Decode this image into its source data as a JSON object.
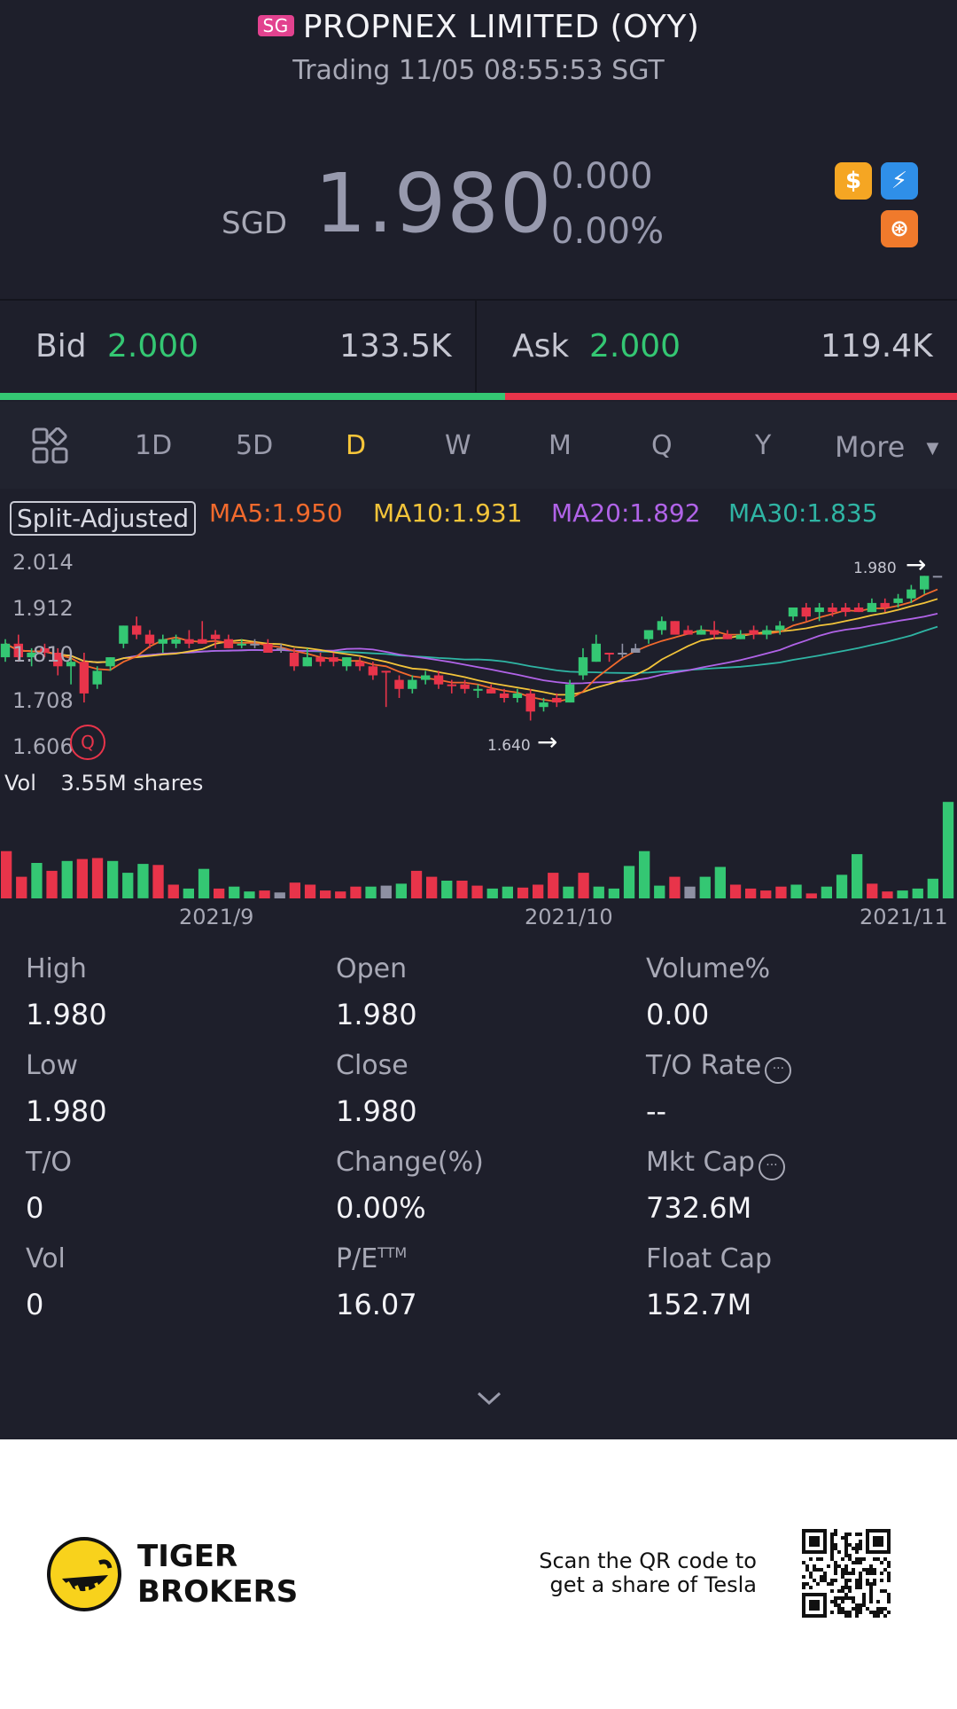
{
  "header": {
    "market_badge": "SG",
    "title": "PROPNEX LIMITED (OYY)",
    "subtitle": "Trading 11/05 08:55:53 SGT"
  },
  "quote": {
    "currency": "SGD",
    "price": "1.980",
    "change": "0.000",
    "change_pct": "0.00%",
    "badges": [
      {
        "icon": "dollar-icon",
        "glyph": "$",
        "color": "#f5a623"
      },
      {
        "icon": "lightning-icon",
        "glyph": "⚡",
        "color": "#2f8fe8"
      },
      {
        "icon": "margin-icon",
        "glyph": "⊛",
        "color": "#f07a2c"
      }
    ]
  },
  "bidask": {
    "bid_label": "Bid",
    "bid_price": "2.000",
    "bid_volume": "133.5K",
    "ask_label": "Ask",
    "ask_price": "2.000",
    "ask_volume": "119.4K",
    "bid_ratio": 0.528,
    "bid_color": "#34c773",
    "ask_color": "#e8344a"
  },
  "tabs": {
    "items": [
      "1D",
      "5D",
      "D",
      "W",
      "M",
      "Q",
      "Y"
    ],
    "active": "D",
    "more_label": "More"
  },
  "indicators": {
    "split_label": "Split-Adjusted",
    "ma5": "MA5:1.950",
    "ma10": "MA10:1.931",
    "ma20": "MA20:1.892",
    "ma30": "MA30:1.835",
    "colors": {
      "ma5": "#f26a2d",
      "ma10": "#f3c43a",
      "ma20": "#b163e8",
      "ma30": "#2fb5a4"
    }
  },
  "chart_data": {
    "type": "candlestick",
    "y_ticks": [
      "2.014",
      "1.912",
      "1.810",
      "1.708",
      "1.606"
    ],
    "ylim": [
      1.606,
      2.014
    ],
    "high_marker": "1.980",
    "low_marker": "1.640",
    "x_ticks": [
      "2021/9",
      "2021/10",
      "2021/11"
    ],
    "volume_label": "Vol",
    "volume_value": "3.55M shares",
    "candles": [
      {
        "o": 1.8,
        "h": 1.84,
        "l": 1.79,
        "c": 1.83,
        "d": "up"
      },
      {
        "o": 1.83,
        "h": 1.85,
        "l": 1.79,
        "c": 1.8,
        "d": "down"
      },
      {
        "o": 1.8,
        "h": 1.82,
        "l": 1.78,
        "c": 1.81,
        "d": "up"
      },
      {
        "o": 1.82,
        "h": 1.83,
        "l": 1.8,
        "c": 1.81,
        "d": "down"
      },
      {
        "o": 1.81,
        "h": 1.82,
        "l": 1.76,
        "c": 1.78,
        "d": "down"
      },
      {
        "o": 1.78,
        "h": 1.8,
        "l": 1.74,
        "c": 1.79,
        "d": "up"
      },
      {
        "o": 1.79,
        "h": 1.81,
        "l": 1.7,
        "c": 1.72,
        "d": "down"
      },
      {
        "o": 1.74,
        "h": 1.78,
        "l": 1.73,
        "c": 1.77,
        "d": "up"
      },
      {
        "o": 1.78,
        "h": 1.8,
        "l": 1.77,
        "c": 1.8,
        "d": "up"
      },
      {
        "o": 1.83,
        "h": 1.87,
        "l": 1.82,
        "c": 1.87,
        "d": "up"
      },
      {
        "o": 1.87,
        "h": 1.89,
        "l": 1.84,
        "c": 1.85,
        "d": "down"
      },
      {
        "o": 1.85,
        "h": 1.86,
        "l": 1.82,
        "c": 1.83,
        "d": "down"
      },
      {
        "o": 1.83,
        "h": 1.85,
        "l": 1.81,
        "c": 1.84,
        "d": "up"
      },
      {
        "o": 1.84,
        "h": 1.85,
        "l": 1.82,
        "c": 1.83,
        "d": "up"
      },
      {
        "o": 1.84,
        "h": 1.86,
        "l": 1.82,
        "c": 1.83,
        "d": "down"
      },
      {
        "o": 1.83,
        "h": 1.88,
        "l": 1.83,
        "c": 1.84,
        "d": "down"
      },
      {
        "o": 1.85,
        "h": 1.86,
        "l": 1.82,
        "c": 1.84,
        "d": "down"
      },
      {
        "o": 1.84,
        "h": 1.85,
        "l": 1.82,
        "c": 1.82,
        "d": "down"
      },
      {
        "o": 1.83,
        "h": 1.84,
        "l": 1.82,
        "c": 1.83,
        "d": "up"
      },
      {
        "o": 1.83,
        "h": 1.84,
        "l": 1.82,
        "c": 1.83,
        "d": "flat"
      },
      {
        "o": 1.83,
        "h": 1.84,
        "l": 1.81,
        "c": 1.81,
        "d": "down"
      },
      {
        "o": 1.82,
        "h": 1.83,
        "l": 1.81,
        "c": 1.82,
        "d": "flat"
      },
      {
        "o": 1.81,
        "h": 1.82,
        "l": 1.77,
        "c": 1.78,
        "d": "down"
      },
      {
        "o": 1.78,
        "h": 1.82,
        "l": 1.78,
        "c": 1.8,
        "d": "up"
      },
      {
        "o": 1.8,
        "h": 1.81,
        "l": 1.78,
        "c": 1.79,
        "d": "down"
      },
      {
        "o": 1.8,
        "h": 1.81,
        "l": 1.78,
        "c": 1.79,
        "d": "down"
      },
      {
        "o": 1.78,
        "h": 1.8,
        "l": 1.77,
        "c": 1.8,
        "d": "up"
      },
      {
        "o": 1.79,
        "h": 1.8,
        "l": 1.77,
        "c": 1.78,
        "d": "down"
      },
      {
        "o": 1.78,
        "h": 1.79,
        "l": 1.75,
        "c": 1.76,
        "d": "down"
      },
      {
        "o": 1.77,
        "h": 1.77,
        "l": 1.69,
        "c": 1.77,
        "d": "down"
      },
      {
        "o": 1.75,
        "h": 1.76,
        "l": 1.71,
        "c": 1.73,
        "d": "down"
      },
      {
        "o": 1.73,
        "h": 1.76,
        "l": 1.72,
        "c": 1.75,
        "d": "up"
      },
      {
        "o": 1.75,
        "h": 1.77,
        "l": 1.74,
        "c": 1.76,
        "d": "up"
      },
      {
        "o": 1.76,
        "h": 1.77,
        "l": 1.73,
        "c": 1.74,
        "d": "down"
      },
      {
        "o": 1.74,
        "h": 1.75,
        "l": 1.72,
        "c": 1.74,
        "d": "down"
      },
      {
        "o": 1.74,
        "h": 1.75,
        "l": 1.72,
        "c": 1.73,
        "d": "down"
      },
      {
        "o": 1.73,
        "h": 1.74,
        "l": 1.71,
        "c": 1.73,
        "d": "up"
      },
      {
        "o": 1.73,
        "h": 1.74,
        "l": 1.72,
        "c": 1.72,
        "d": "down"
      },
      {
        "o": 1.72,
        "h": 1.73,
        "l": 1.7,
        "c": 1.71,
        "d": "down"
      },
      {
        "o": 1.71,
        "h": 1.73,
        "l": 1.7,
        "c": 1.72,
        "d": "up"
      },
      {
        "o": 1.72,
        "h": 1.73,
        "l": 1.66,
        "c": 1.68,
        "d": "down"
      },
      {
        "o": 1.69,
        "h": 1.71,
        "l": 1.68,
        "c": 1.7,
        "d": "up"
      },
      {
        "o": 1.71,
        "h": 1.72,
        "l": 1.69,
        "c": 1.7,
        "d": "down"
      },
      {
        "o": 1.7,
        "h": 1.75,
        "l": 1.7,
        "c": 1.74,
        "d": "up"
      },
      {
        "o": 1.76,
        "h": 1.82,
        "l": 1.75,
        "c": 1.8,
        "d": "up"
      },
      {
        "o": 1.79,
        "h": 1.85,
        "l": 1.79,
        "c": 1.83,
        "d": "up"
      },
      {
        "o": 1.81,
        "h": 1.81,
        "l": 1.79,
        "c": 1.81,
        "d": "down"
      },
      {
        "o": 1.81,
        "h": 1.83,
        "l": 1.8,
        "c": 1.81,
        "d": "flat"
      },
      {
        "o": 1.81,
        "h": 1.83,
        "l": 1.81,
        "c": 1.82,
        "d": "flat"
      },
      {
        "o": 1.84,
        "h": 1.86,
        "l": 1.83,
        "c": 1.86,
        "d": "up"
      },
      {
        "o": 1.86,
        "h": 1.89,
        "l": 1.85,
        "c": 1.88,
        "d": "up"
      },
      {
        "o": 1.88,
        "h": 1.88,
        "l": 1.86,
        "c": 1.85,
        "d": "down"
      },
      {
        "o": 1.86,
        "h": 1.87,
        "l": 1.85,
        "c": 1.85,
        "d": "down"
      },
      {
        "o": 1.85,
        "h": 1.87,
        "l": 1.85,
        "c": 1.86,
        "d": "up"
      },
      {
        "o": 1.86,
        "h": 1.88,
        "l": 1.84,
        "c": 1.85,
        "d": "down"
      },
      {
        "o": 1.85,
        "h": 1.86,
        "l": 1.84,
        "c": 1.84,
        "d": "down"
      },
      {
        "o": 1.84,
        "h": 1.86,
        "l": 1.84,
        "c": 1.85,
        "d": "up"
      },
      {
        "o": 1.85,
        "h": 1.87,
        "l": 1.84,
        "c": 1.86,
        "d": "down"
      },
      {
        "o": 1.85,
        "h": 1.87,
        "l": 1.84,
        "c": 1.86,
        "d": "up"
      },
      {
        "o": 1.86,
        "h": 1.88,
        "l": 1.85,
        "c": 1.87,
        "d": "up"
      },
      {
        "o": 1.89,
        "h": 1.91,
        "l": 1.88,
        "c": 1.91,
        "d": "up"
      },
      {
        "o": 1.91,
        "h": 1.92,
        "l": 1.88,
        "c": 1.89,
        "d": "down"
      },
      {
        "o": 1.9,
        "h": 1.92,
        "l": 1.88,
        "c": 1.91,
        "d": "up"
      },
      {
        "o": 1.91,
        "h": 1.92,
        "l": 1.89,
        "c": 1.9,
        "d": "down"
      },
      {
        "o": 1.9,
        "h": 1.92,
        "l": 1.89,
        "c": 1.91,
        "d": "down"
      },
      {
        "o": 1.91,
        "h": 1.92,
        "l": 1.9,
        "c": 1.9,
        "d": "down"
      },
      {
        "o": 1.9,
        "h": 1.93,
        "l": 1.9,
        "c": 1.92,
        "d": "up"
      },
      {
        "o": 1.92,
        "h": 1.93,
        "l": 1.9,
        "c": 1.91,
        "d": "down"
      },
      {
        "o": 1.92,
        "h": 1.94,
        "l": 1.91,
        "c": 1.93,
        "d": "up"
      },
      {
        "o": 1.93,
        "h": 1.96,
        "l": 1.92,
        "c": 1.95,
        "d": "up"
      },
      {
        "o": 1.95,
        "h": 1.98,
        "l": 1.94,
        "c": 1.98,
        "d": "up"
      },
      {
        "o": 1.98,
        "h": 1.98,
        "l": 1.98,
        "c": 1.98,
        "d": "flat"
      }
    ],
    "volumes": [
      {
        "v": 0.48,
        "d": "down"
      },
      {
        "v": 0.22,
        "d": "down"
      },
      {
        "v": 0.36,
        "d": "up"
      },
      {
        "v": 0.28,
        "d": "down"
      },
      {
        "v": 0.38,
        "d": "up"
      },
      {
        "v": 0.4,
        "d": "down"
      },
      {
        "v": 0.41,
        "d": "down"
      },
      {
        "v": 0.38,
        "d": "up"
      },
      {
        "v": 0.26,
        "d": "up"
      },
      {
        "v": 0.35,
        "d": "up"
      },
      {
        "v": 0.34,
        "d": "down"
      },
      {
        "v": 0.14,
        "d": "down"
      },
      {
        "v": 0.1,
        "d": "up"
      },
      {
        "v": 0.3,
        "d": "up"
      },
      {
        "v": 0.1,
        "d": "down"
      },
      {
        "v": 0.12,
        "d": "up"
      },
      {
        "v": 0.07,
        "d": "up"
      },
      {
        "v": 0.08,
        "d": "down"
      },
      {
        "v": 0.06,
        "d": "flat"
      },
      {
        "v": 0.16,
        "d": "down"
      },
      {
        "v": 0.14,
        "d": "down"
      },
      {
        "v": 0.08,
        "d": "down"
      },
      {
        "v": 0.07,
        "d": "down"
      },
      {
        "v": 0.12,
        "d": "down"
      },
      {
        "v": 0.12,
        "d": "up"
      },
      {
        "v": 0.13,
        "d": "flat"
      },
      {
        "v": 0.15,
        "d": "up"
      },
      {
        "v": 0.28,
        "d": "down"
      },
      {
        "v": 0.22,
        "d": "down"
      },
      {
        "v": 0.18,
        "d": "up"
      },
      {
        "v": 0.18,
        "d": "down"
      },
      {
        "v": 0.13,
        "d": "down"
      },
      {
        "v": 0.1,
        "d": "up"
      },
      {
        "v": 0.12,
        "d": "up"
      },
      {
        "v": 0.11,
        "d": "down"
      },
      {
        "v": 0.14,
        "d": "down"
      },
      {
        "v": 0.26,
        "d": "down"
      },
      {
        "v": 0.12,
        "d": "up"
      },
      {
        "v": 0.26,
        "d": "down"
      },
      {
        "v": 0.12,
        "d": "up"
      },
      {
        "v": 0.1,
        "d": "up"
      },
      {
        "v": 0.33,
        "d": "up"
      },
      {
        "v": 0.48,
        "d": "up"
      },
      {
        "v": 0.13,
        "d": "up"
      },
      {
        "v": 0.22,
        "d": "down"
      },
      {
        "v": 0.12,
        "d": "flat"
      },
      {
        "v": 0.22,
        "d": "up"
      },
      {
        "v": 0.32,
        "d": "up"
      },
      {
        "v": 0.14,
        "d": "down"
      },
      {
        "v": 0.1,
        "d": "down"
      },
      {
        "v": 0.08,
        "d": "down"
      },
      {
        "v": 0.12,
        "d": "down"
      },
      {
        "v": 0.14,
        "d": "up"
      },
      {
        "v": 0.05,
        "d": "down"
      },
      {
        "v": 0.12,
        "d": "up"
      },
      {
        "v": 0.24,
        "d": "up"
      },
      {
        "v": 0.45,
        "d": "up"
      },
      {
        "v": 0.15,
        "d": "down"
      },
      {
        "v": 0.07,
        "d": "down"
      },
      {
        "v": 0.08,
        "d": "up"
      },
      {
        "v": 0.1,
        "d": "up"
      },
      {
        "v": 0.2,
        "d": "up"
      },
      {
        "v": 0.98,
        "d": "up"
      }
    ]
  },
  "stats": [
    {
      "label": "High",
      "value": "1.980"
    },
    {
      "label": "Open",
      "value": "1.980"
    },
    {
      "label": "Volume%",
      "value": "0.00"
    },
    {
      "label": "Low",
      "value": "1.980"
    },
    {
      "label": "Close",
      "value": "1.980"
    },
    {
      "label": "T/O Rate",
      "value": "--",
      "info": true
    },
    {
      "label": "T/O",
      "value": "0"
    },
    {
      "label": "Change(%)",
      "value": "0.00%"
    },
    {
      "label": "Mkt Cap",
      "value": "732.6M",
      "info": true
    },
    {
      "label": "Vol",
      "value": "0"
    },
    {
      "label": "P/E",
      "sup": "TTM",
      "value": "16.07"
    },
    {
      "label": "Float Cap",
      "value": "152.7M"
    }
  ],
  "footer": {
    "brand_line1": "TIGER",
    "brand_line2": "BROKERS",
    "promo_line1": "Scan the QR code to",
    "promo_line2": "get a share of Tesla"
  }
}
